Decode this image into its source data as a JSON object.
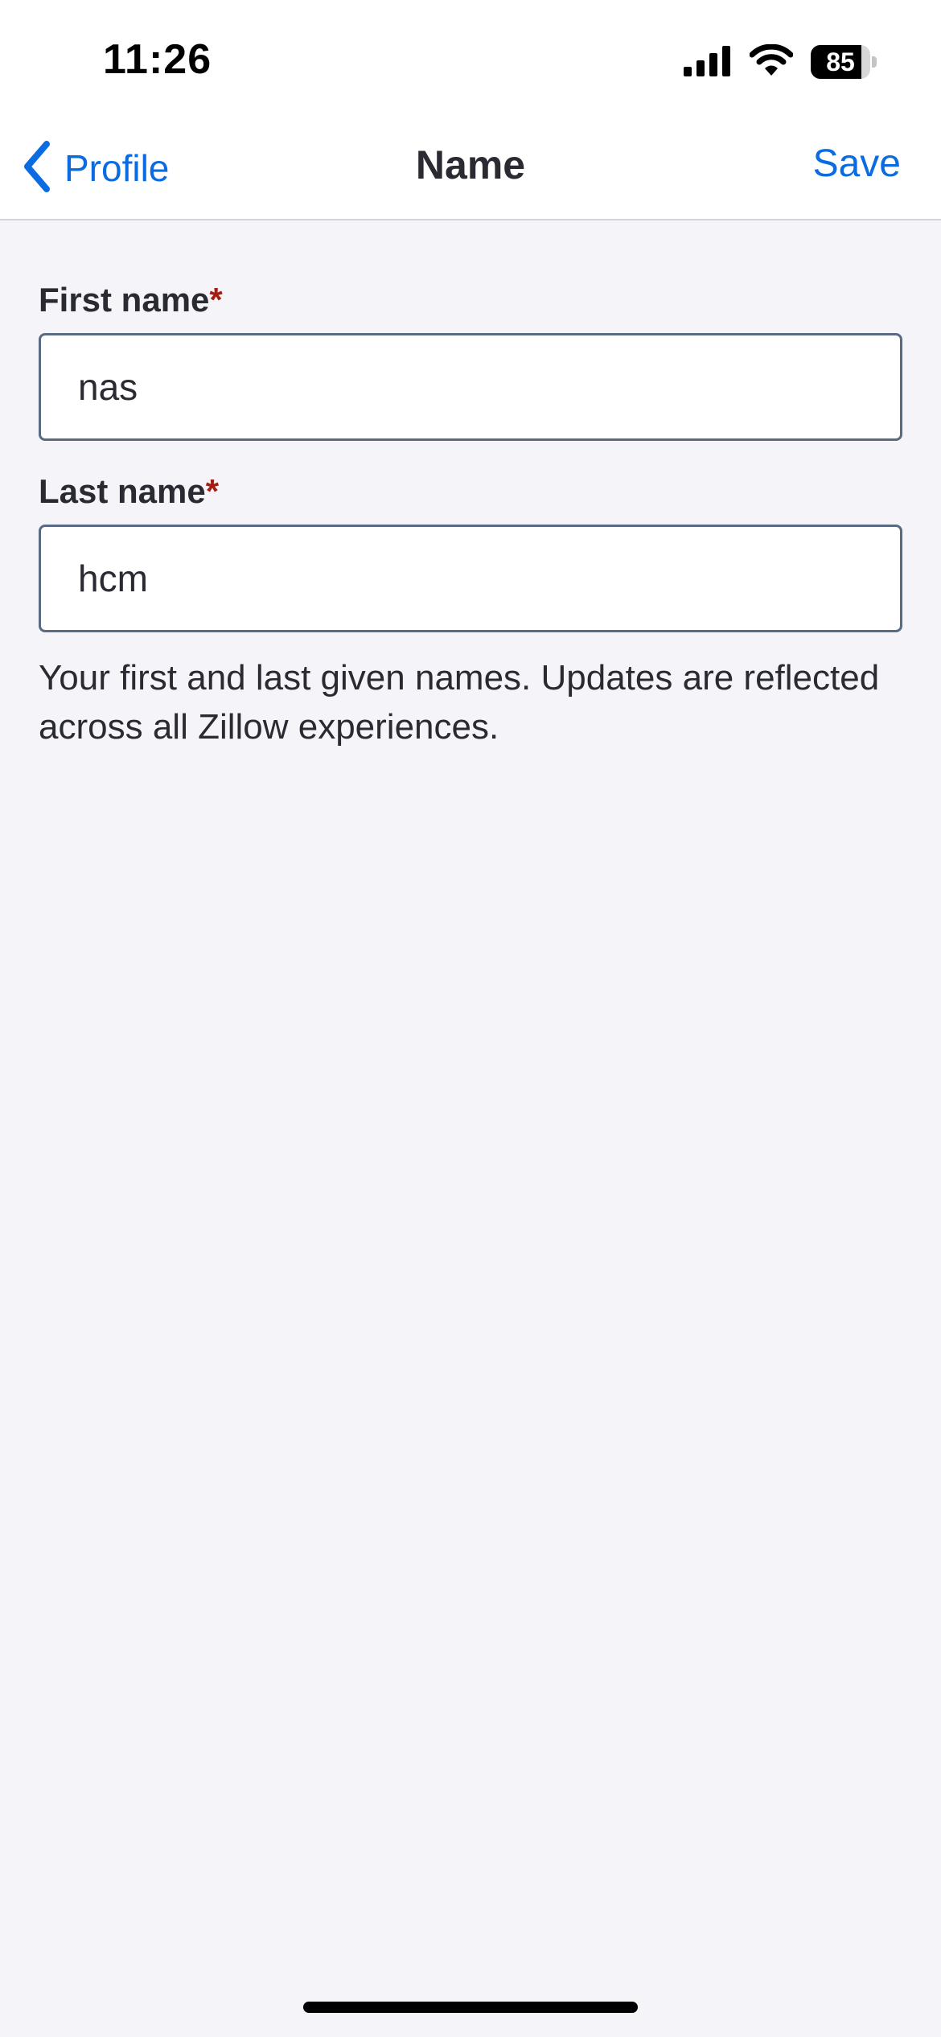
{
  "status_bar": {
    "time": "11:26",
    "battery_level": "85",
    "battery_fraction": 0.85,
    "icons": [
      "cellular-signal-icon",
      "wifi-icon",
      "battery-icon"
    ]
  },
  "nav": {
    "back_label": "Profile",
    "title": "Name",
    "save_label": "Save",
    "icons": [
      "chevron-left-icon"
    ]
  },
  "form": {
    "first_name": {
      "label": "First name",
      "required_mark": "*",
      "value": "nas"
    },
    "last_name": {
      "label": "Last name",
      "required_mark": "*",
      "value": "hcm"
    },
    "helper_text": "Your first and last given names. Updates are reflected across all Zillow experiences."
  },
  "colors": {
    "accent": "#0a6ce0",
    "required": "#a51d10",
    "text": "#2a2a33",
    "background": "#f4f4f9",
    "input_border": "#596b82"
  }
}
